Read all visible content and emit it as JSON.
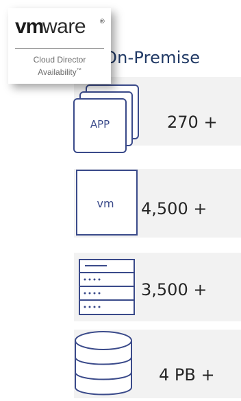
{
  "logo": {
    "brand_vm": "vm",
    "brand_ware": "ware",
    "registered": "®",
    "product_line1": "Cloud Director",
    "product_line2": "Availability",
    "trademark": "™"
  },
  "heading": "On-Premise",
  "stats": [
    {
      "icon": "app-stack-icon",
      "icon_label": "APP",
      "value": "270 +"
    },
    {
      "icon": "vm-box-icon",
      "icon_label": "vm",
      "value": "4,500 +"
    },
    {
      "icon": "server-rack-icon",
      "value": "3,500 +"
    },
    {
      "icon": "database-icon",
      "value": "4 PB +"
    }
  ],
  "colors": {
    "icon_stroke": "#3a4a8a",
    "heading": "#1f3864",
    "panel_background": "#f2f2f2",
    "value_text": "#262626"
  }
}
